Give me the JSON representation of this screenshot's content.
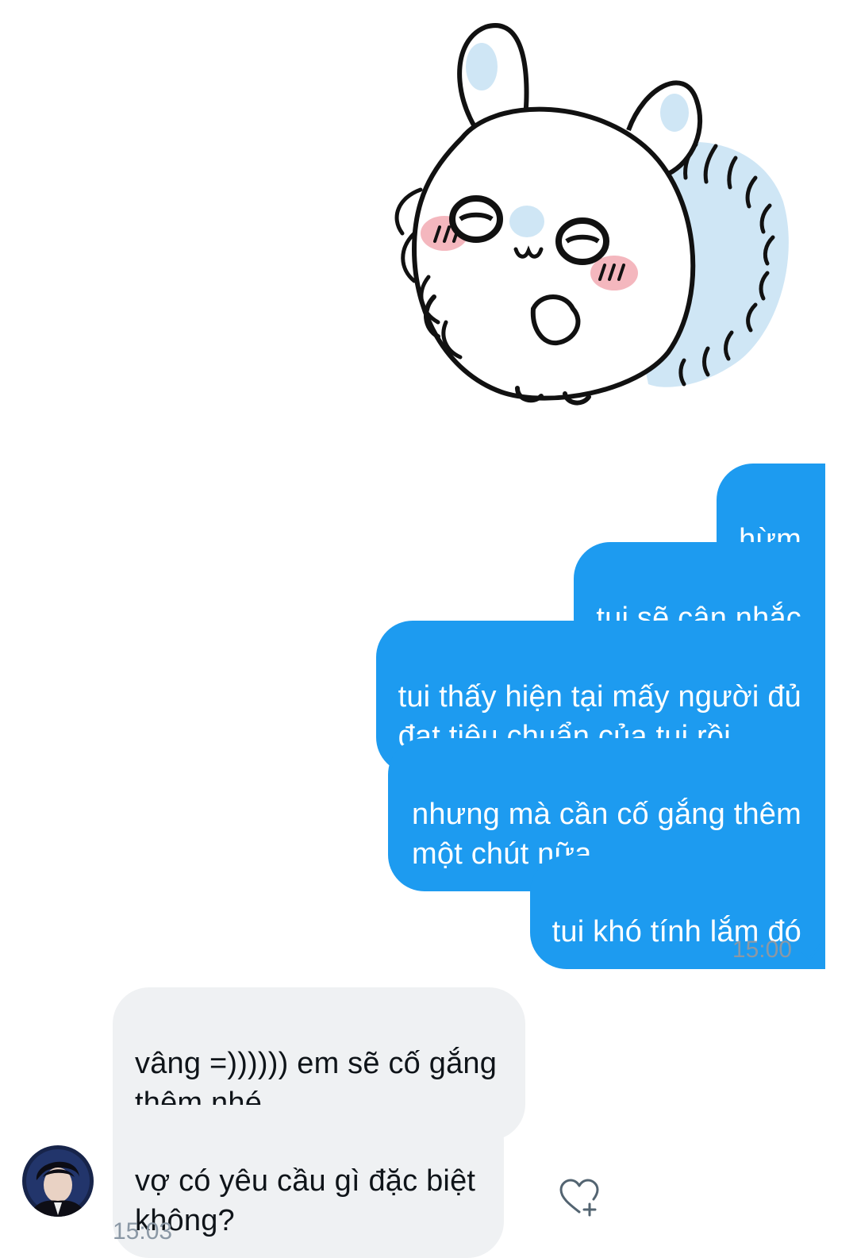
{
  "sticker": {
    "icon": "white-squirrel-sticker"
  },
  "outgoing": {
    "messages": [
      {
        "text": "hừm"
      },
      {
        "text": "tui sẽ cân nhắc"
      },
      {
        "text": "tui thấy hiện tại mấy người đủ\nđạt tiêu chuẩn của tui rồi"
      },
      {
        "text": "nhưng mà cần cố gắng thêm\nmột chút nữa"
      },
      {
        "text": "tui khó tính lắm đó"
      }
    ],
    "time": "15:00",
    "status_icon": "check-icon",
    "color": "#1d9bf0"
  },
  "incoming": {
    "messages": [
      {
        "text": "vâng =)))))) em sẽ cố gắng\nthêm nhé"
      },
      {
        "text": "vợ có yêu cầu gì đặc biệt\nkhông?"
      }
    ],
    "time": "15:03",
    "avatar_icon": "avatar",
    "react_icon": "heart-plus-icon",
    "color": "#eff1f3"
  }
}
